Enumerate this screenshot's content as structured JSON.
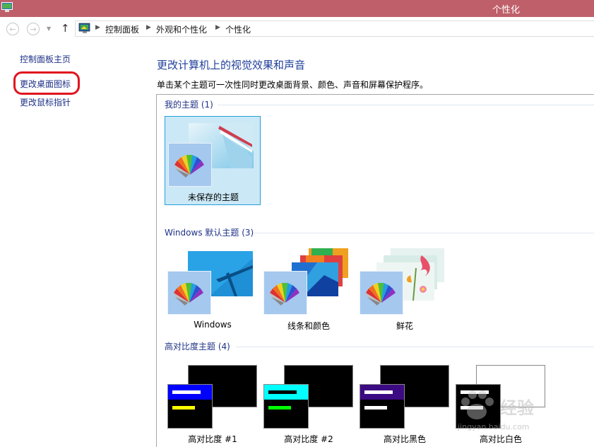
{
  "window": {
    "title": "个性化"
  },
  "breadcrumb": {
    "items": [
      "控制面板",
      "外观和个性化",
      "个性化"
    ]
  },
  "left_pane": {
    "links": [
      "控制面板主页",
      "更改桌面图标",
      "更改鼠标指针"
    ]
  },
  "main": {
    "heading": "更改计算机上的视觉效果和声音",
    "description": "单击某个主题可一次性同时更改桌面背景、颜色、声音和屏幕保护程序。"
  },
  "groups": {
    "my_themes": {
      "label": "我的主题 (1)",
      "themes": [
        {
          "name": "未保存的主题",
          "selected": true
        }
      ]
    },
    "windows_default": {
      "label": "Windows 默认主题 (3)",
      "themes": [
        {
          "name": "Windows"
        },
        {
          "name": "线条和颜色"
        },
        {
          "name": "鲜花"
        }
      ]
    },
    "high_contrast": {
      "label": "高对比度主题 (4)",
      "themes": [
        {
          "name": "高对比度 #1",
          "accent": "#0000ff",
          "bar": "#ffff00"
        },
        {
          "name": "高对比度 #2",
          "accent": "#00ffff",
          "bar": "#00ff00"
        },
        {
          "name": "高对比黑色",
          "accent": "#3c0a82",
          "bar": "#ffffff"
        },
        {
          "name": "高对比白色",
          "accent": "#ffffff",
          "bar": "#000000"
        }
      ]
    }
  },
  "colors": {
    "titlebar": "#bf5f6a",
    "link": "#1e3287",
    "heading": "#1f3f9b",
    "selection": "#cbe8f6",
    "highlight_ring": "#e0141e"
  },
  "watermark": {
    "text": "经验",
    "url": "jingyan.baidu.com"
  }
}
